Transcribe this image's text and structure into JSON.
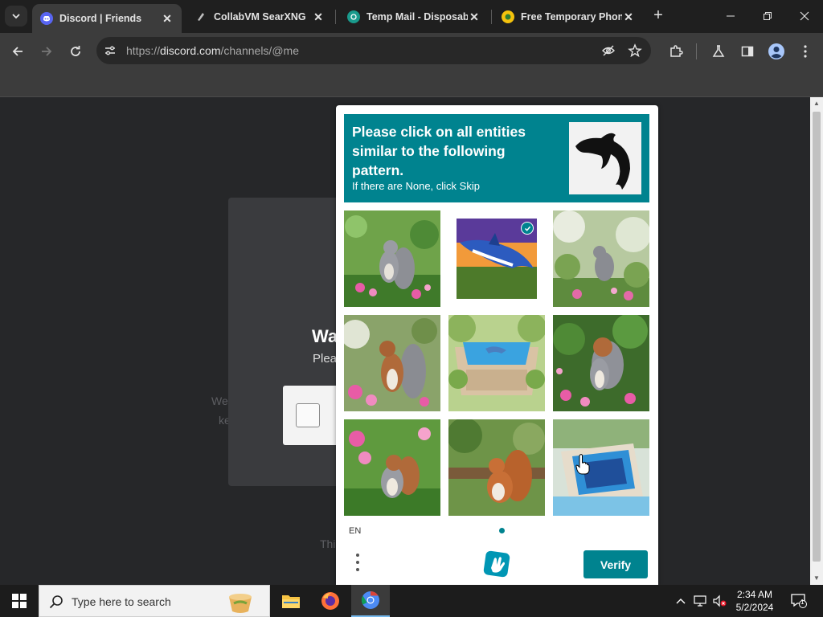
{
  "browser": {
    "tabs": [
      {
        "title": "Discord | Friends",
        "active": true
      },
      {
        "title": "CollabVM SearXNG",
        "active": false
      },
      {
        "title": "Temp Mail - Disposable",
        "active": false
      },
      {
        "title": "Free Temporary Phone",
        "active": false
      }
    ],
    "new_tab_label": "+",
    "url_scheme": "https://",
    "url_host": "discord.com",
    "url_path": "/channels/@me"
  },
  "discord": {
    "modal_title": "Wa",
    "modal_subtitle": "Plea",
    "side_text_1": "We",
    "side_text_2": "ke",
    "footer_text": "Thi"
  },
  "captcha": {
    "prompt_title": "Please click on all entities similar to the following pattern.",
    "prompt_hint": "If there are None, click Skip",
    "sample_icon": "dolphin-silhouette",
    "tiles": [
      {
        "subject": "squirrel",
        "selected": false
      },
      {
        "subject": "dolphin",
        "selected": true
      },
      {
        "subject": "squirrel",
        "selected": false
      },
      {
        "subject": "squirrel",
        "selected": false
      },
      {
        "subject": "pool",
        "selected": false
      },
      {
        "subject": "squirrel",
        "selected": false
      },
      {
        "subject": "squirrel",
        "selected": false
      },
      {
        "subject": "squirrel",
        "selected": false
      },
      {
        "subject": "pool",
        "selected": false
      }
    ],
    "language": "EN",
    "verify_label": "Verify",
    "accent_color": "#00838f"
  },
  "taskbar": {
    "search_placeholder": "Type here to search",
    "time": "2:34 AM",
    "date": "5/2/2024",
    "notification_count": "1"
  }
}
